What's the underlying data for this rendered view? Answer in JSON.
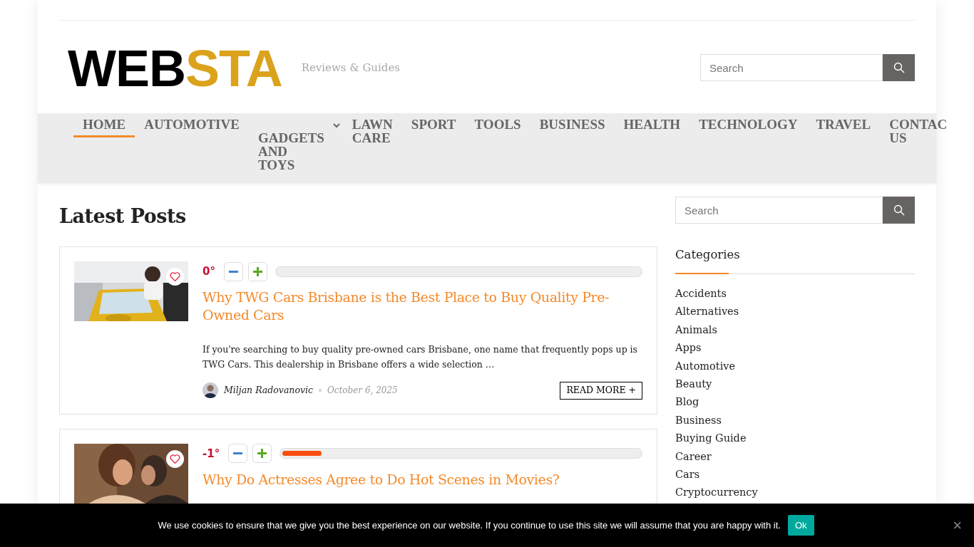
{
  "header": {
    "logo": {
      "first": "WEB",
      "second": "STA"
    },
    "tagline": "Reviews & Guides",
    "search": {
      "placeholder": "Search"
    }
  },
  "nav": {
    "items": [
      {
        "label": "HOME",
        "selected": true,
        "has_submenu": false
      },
      {
        "label": "AUTOMOTIVE",
        "selected": false,
        "has_submenu": false
      },
      {
        "label": "GADGETS AND TOYS",
        "selected": false,
        "has_submenu": true
      },
      {
        "label": "LAWN CARE",
        "selected": false,
        "has_submenu": false
      },
      {
        "label": "SPORT",
        "selected": false,
        "has_submenu": false
      },
      {
        "label": "TOOLS",
        "selected": false,
        "has_submenu": false
      },
      {
        "label": "BUSINESS",
        "selected": false,
        "has_submenu": false
      },
      {
        "label": "HEALTH",
        "selected": false,
        "has_submenu": false
      },
      {
        "label": "TECHNOLOGY",
        "selected": false,
        "has_submenu": false
      },
      {
        "label": "TRAVEL",
        "selected": false,
        "has_submenu": false
      },
      {
        "label": "CONTAC US",
        "selected": false,
        "has_submenu": false
      }
    ]
  },
  "main": {
    "heading": "Latest Posts",
    "posts": [
      {
        "score": "0°",
        "level": 0,
        "title": "Why TWG Cars Brisbane is the Best Place to Buy Quality Pre-Owned Cars",
        "excerpt": "If you're searching to buy quality pre-owned cars Brisbane, one name that frequently pops up is TWG Cars. This dealership in Brisbane offers a wide selection …",
        "author": "Miljan Radovanovic",
        "date": "October 6, 2025",
        "read_more": "READ MORE +"
      },
      {
        "score": "-1°",
        "level": 0.11,
        "title": "Why Do Actresses Agree to Do Hot Scenes in Movies?"
      }
    ]
  },
  "sidebar": {
    "search": {
      "placeholder": "Search"
    },
    "categories": {
      "title": "Categories",
      "items": [
        "Accidents",
        "Alternatives",
        "Animals",
        "Apps",
        "Automotive",
        "Beauty",
        "Blog",
        "Business",
        "Buying Guide",
        "Career",
        "Cars",
        "Cryptocurrency"
      ]
    }
  },
  "cookie_bar": {
    "text": "We use cookies to ensure that we give you the best experience on our website. If you continue to use this site we will assume that you are happy with it.",
    "button": "Ok",
    "close": "×"
  }
}
